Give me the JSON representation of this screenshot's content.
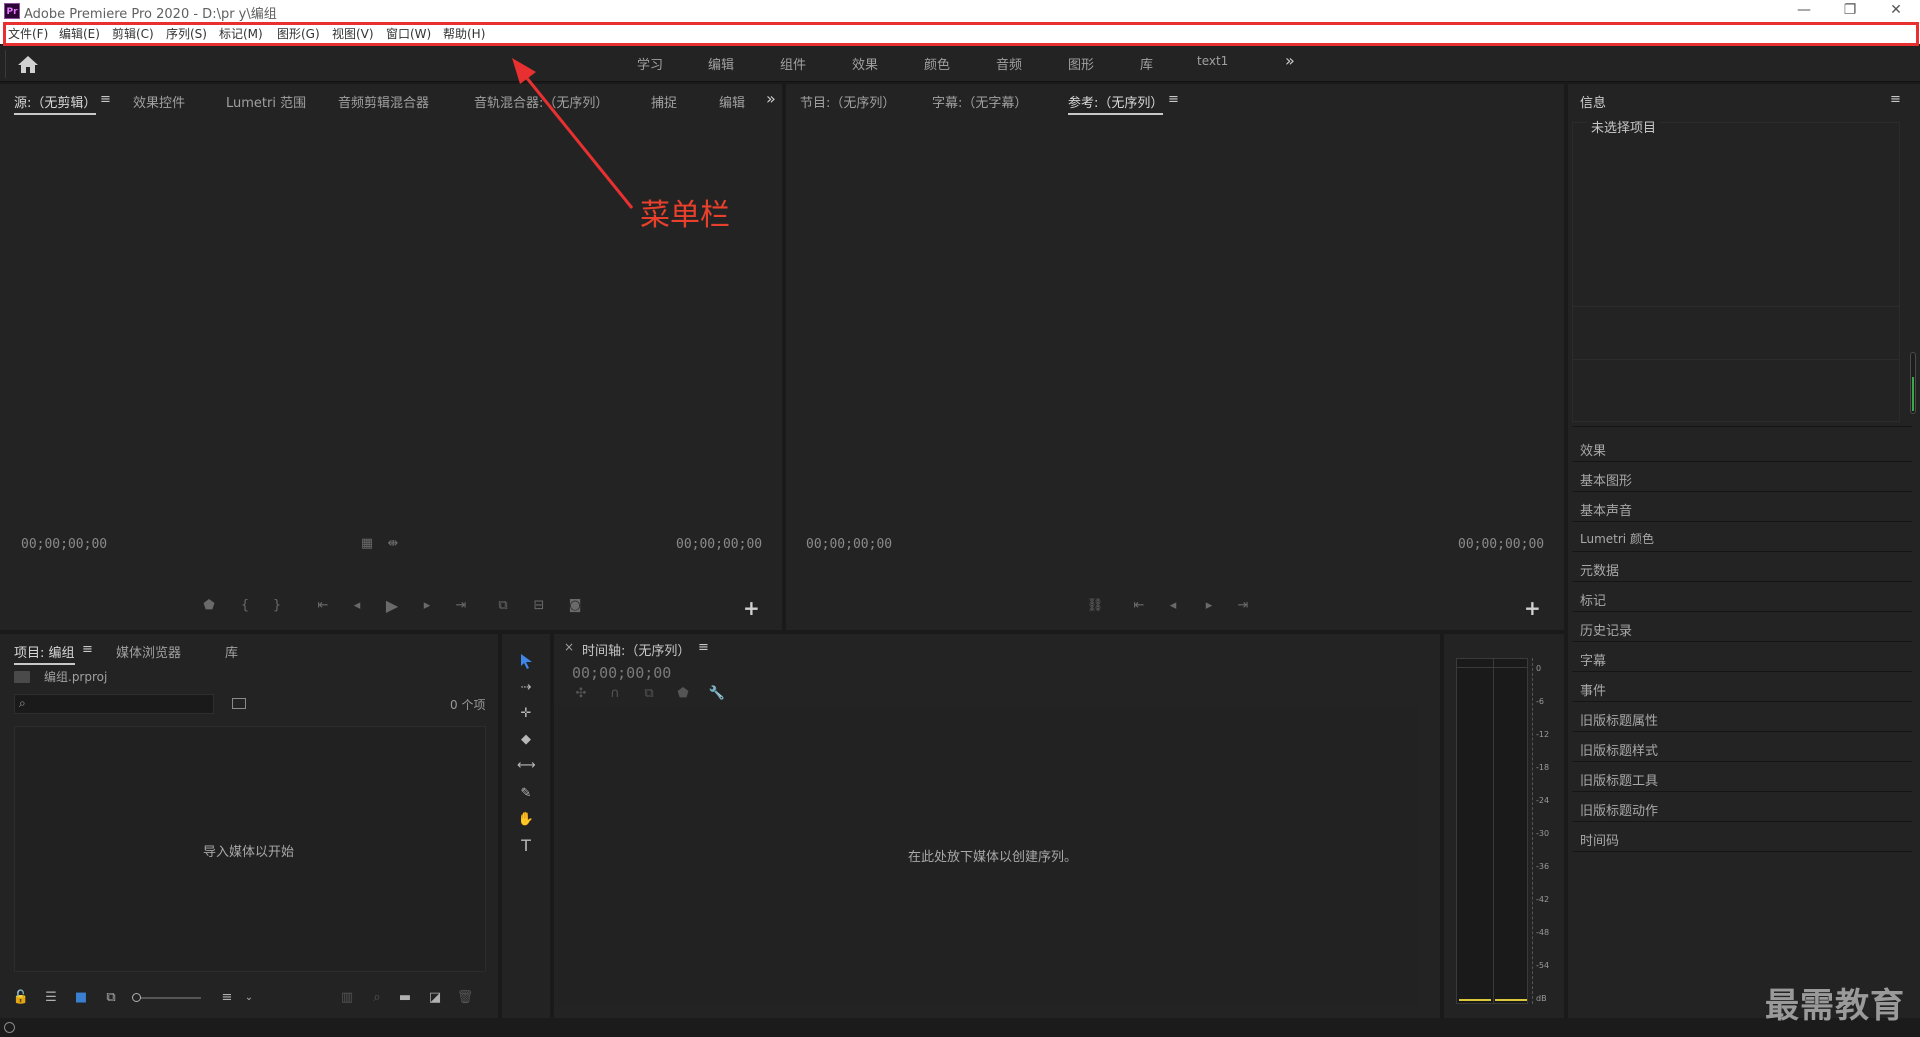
{
  "window": {
    "logo_text": "Pr",
    "title": "Adobe Premiere Pro 2020 - D:\\pr y\\编组",
    "minimize": "—",
    "restore": "❐",
    "close": "✕"
  },
  "menubar": {
    "items": [
      "文件(F)",
      "编辑(E)",
      "剪辑(C)",
      "序列(S)",
      "标记(M)",
      "图形(G)",
      "视图(V)",
      "窗口(W)",
      "帮助(H)"
    ]
  },
  "workspace": {
    "tabs": [
      "学习",
      "编辑",
      "组件",
      "效果",
      "颜色",
      "音频",
      "图形",
      "库",
      "text1"
    ],
    "more": "»"
  },
  "source_panel": {
    "tabs": [
      "源:（无剪辑）",
      "效果控件",
      "Lumetri 范围",
      "音频剪辑混合器",
      "音轨混合器:（无序列）",
      "捕捉",
      "编辑"
    ],
    "menu_icon": "≡",
    "more": "»",
    "timecode_left": "00;00;00;00",
    "timecode_right": "00;00;00;00",
    "add": "+"
  },
  "program_panel": {
    "tabs": [
      "节目:（无序列）",
      "字幕:（无字幕）",
      "参考:（无序列）"
    ],
    "menu_icon": "≡",
    "timecode_left": "00;00;00;00",
    "timecode_right": "00;00;00;00",
    "add": "+"
  },
  "right_panel": {
    "title": "信息",
    "menu_icon": "≡",
    "info_text": "未选择项目",
    "items": [
      "效果",
      "基本图形",
      "基本声音",
      "Lumetri 颜色",
      "元数据",
      "标记",
      "历史记录",
      "字幕",
      "事件",
      "旧版标题属性",
      "旧版标题样式",
      "旧版标题工具",
      "旧版标题动作",
      "时间码"
    ]
  },
  "project_panel": {
    "tabs": [
      "项目: 编组",
      "媒体浏览器",
      "库"
    ],
    "menu_icon": "≡",
    "project_file": "编组.prproj",
    "item_count": "0 个项",
    "empty_text": "导入媒体以开始"
  },
  "timeline_panel": {
    "close": "×",
    "title": "时间轴:（无序列）",
    "menu_icon": "≡",
    "timecode": "00;00;00;00",
    "empty_text": "在此处放下媒体以创建序列。"
  },
  "audio_meter": {
    "scale": [
      "0",
      "-6",
      "-12",
      "-18",
      "-24",
      "-30",
      "-36",
      "-42",
      "-48",
      "-54",
      "dB"
    ]
  },
  "annotation": {
    "label": "菜单栏",
    "color": "#e83030"
  },
  "watermark": "最需教育"
}
